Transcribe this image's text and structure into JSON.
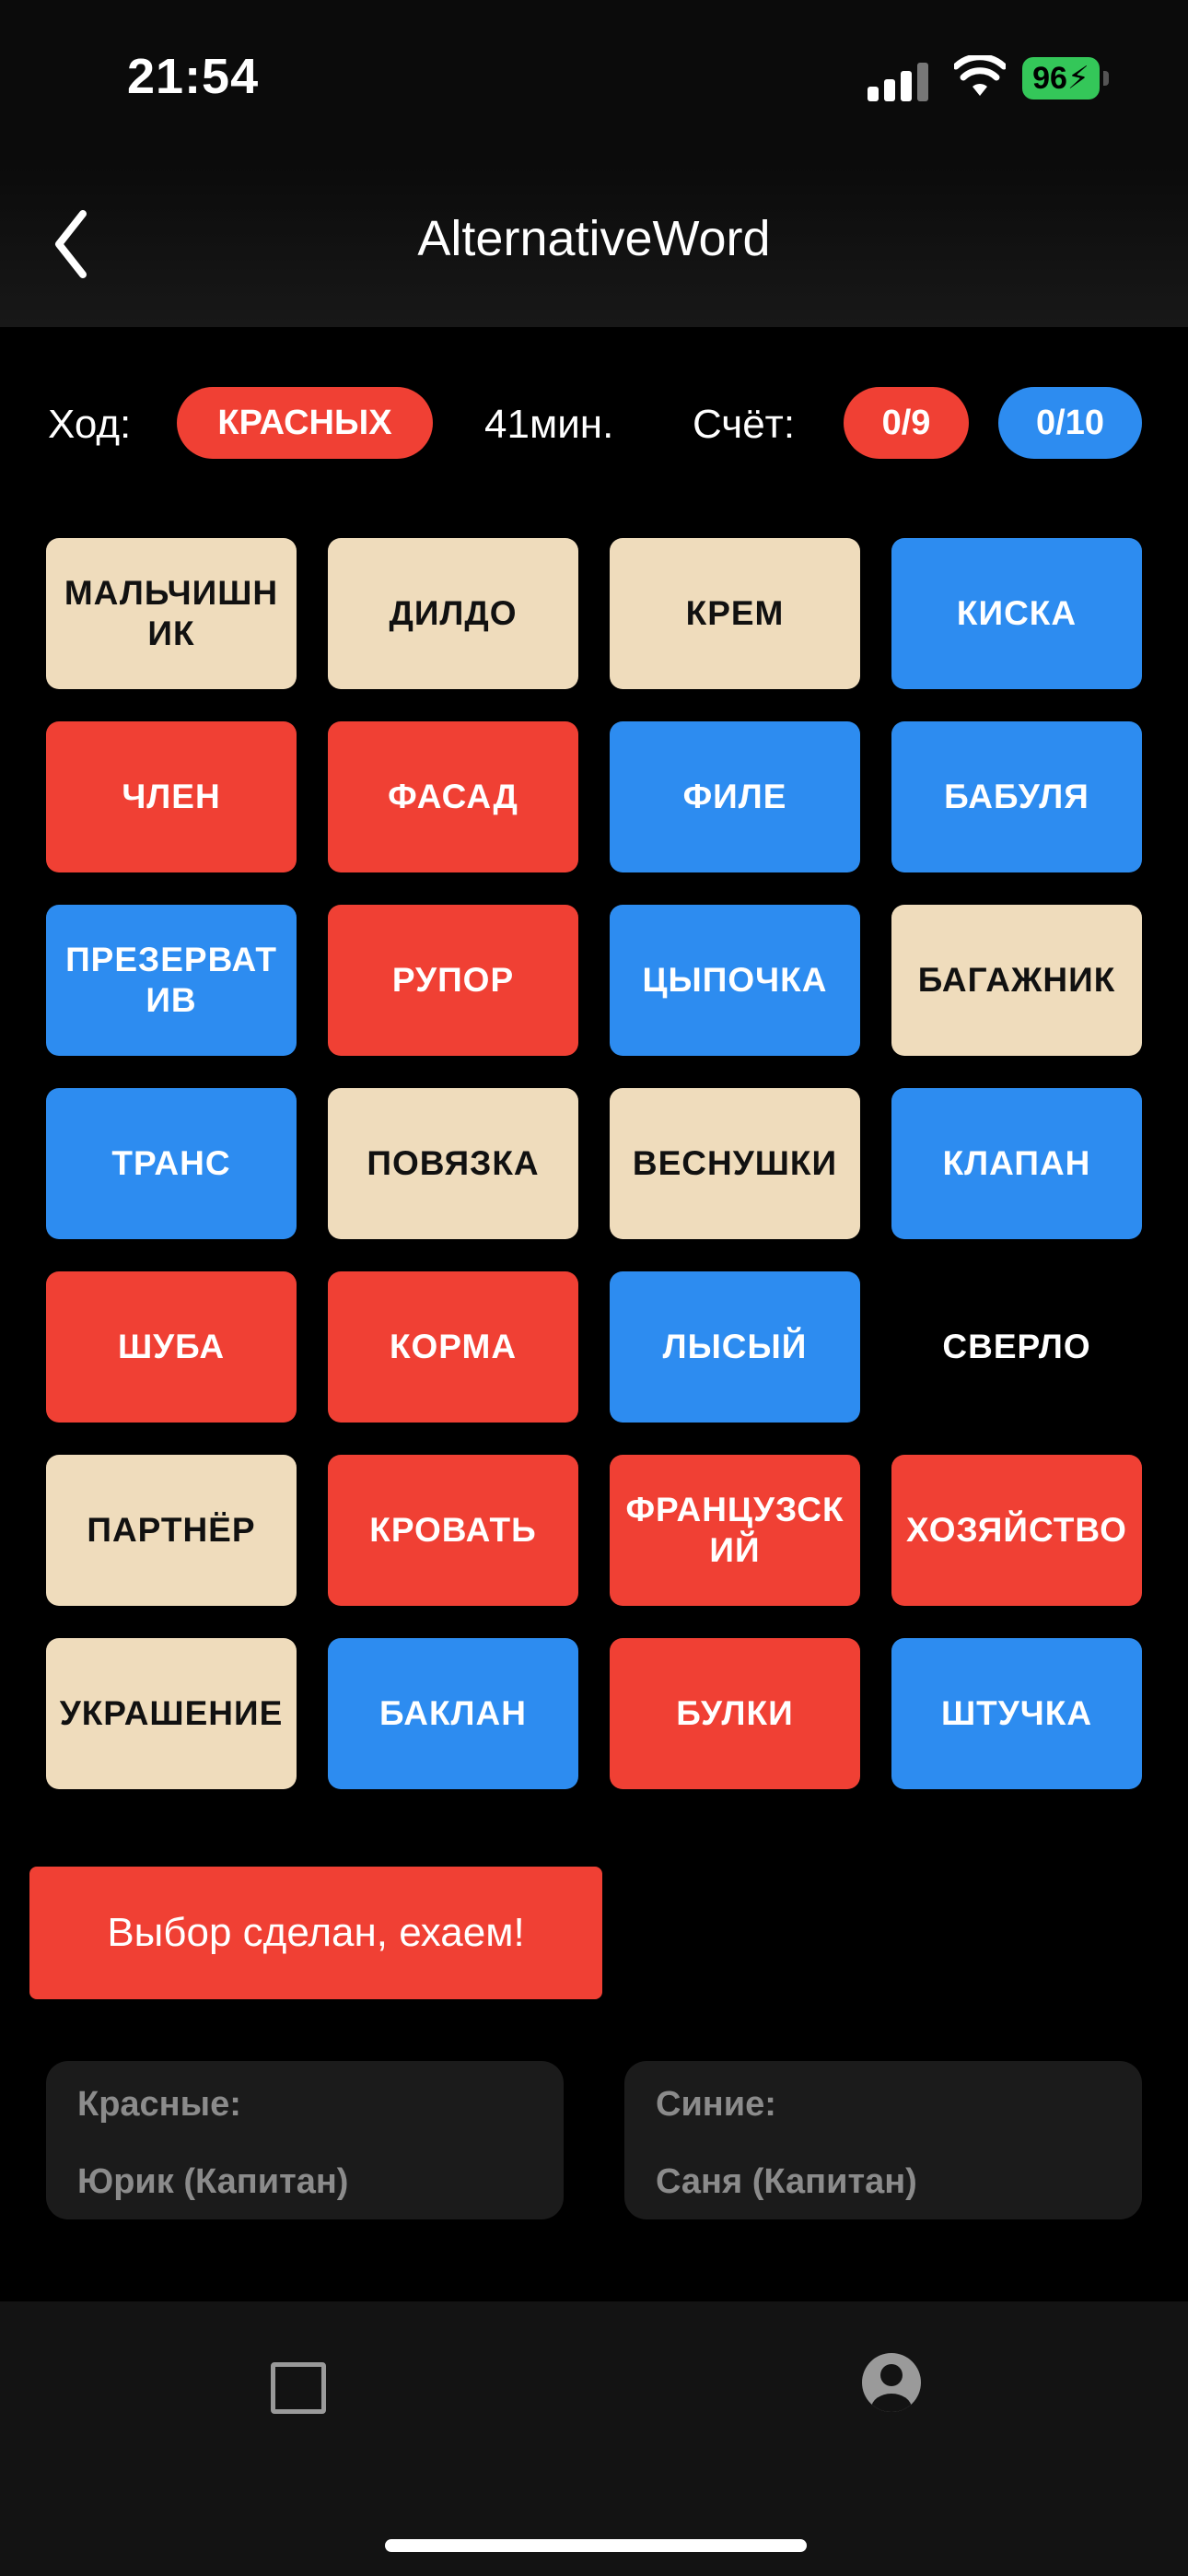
{
  "status": {
    "time": "21:54",
    "battery": "96"
  },
  "nav": {
    "title": "AlternativeWord",
    "back_icon": "chevron-left-icon"
  },
  "info": {
    "turn_label": "Ход:",
    "turn_team": "КРАСНЫХ",
    "timer": "41мин.",
    "score_label": "Счёт:",
    "score_red": "0/9",
    "score_blue": "0/10"
  },
  "colors": {
    "red": "#f04034",
    "blue": "#2d8cf0",
    "beige": "#efdcbc",
    "black": "#000000"
  },
  "cards": [
    {
      "word": "МАЛЬЧИШНИК",
      "color": "beige"
    },
    {
      "word": "ДИЛДО",
      "color": "beige"
    },
    {
      "word": "КРЕМ",
      "color": "beige"
    },
    {
      "word": "КИСКА",
      "color": "blue"
    },
    {
      "word": "ЧЛЕН",
      "color": "red"
    },
    {
      "word": "ФАСАД",
      "color": "red"
    },
    {
      "word": "ФИЛЕ",
      "color": "blue"
    },
    {
      "word": "БАБУЛЯ",
      "color": "blue"
    },
    {
      "word": "ПРЕЗЕРВАТИВ",
      "color": "blue"
    },
    {
      "word": "РУПОР",
      "color": "red"
    },
    {
      "word": "ЦЫПОЧКА",
      "color": "blue"
    },
    {
      "word": "БАГАЖНИК",
      "color": "beige"
    },
    {
      "word": "ТРАНС",
      "color": "blue"
    },
    {
      "word": "ПОВЯЗКА",
      "color": "beige"
    },
    {
      "word": "ВЕСНУШКИ",
      "color": "beige"
    },
    {
      "word": "КЛАПАН",
      "color": "blue"
    },
    {
      "word": "ШУБА",
      "color": "red"
    },
    {
      "word": "КОРМА",
      "color": "red"
    },
    {
      "word": "ЛЫСЫЙ",
      "color": "blue"
    },
    {
      "word": "СВЕРЛО",
      "color": "black"
    },
    {
      "word": "ПАРТНЁР",
      "color": "beige"
    },
    {
      "word": "КРОВАТЬ",
      "color": "red"
    },
    {
      "word": "ФРАНЦУЗСКИЙ",
      "color": "red"
    },
    {
      "word": "ХОЗЯЙСТВО",
      "color": "red"
    },
    {
      "word": "УКРАШЕНИЕ",
      "color": "beige"
    },
    {
      "word": "БАКЛАН",
      "color": "blue"
    },
    {
      "word": "БУЛКИ",
      "color": "red"
    },
    {
      "word": "ШТУЧКА",
      "color": "blue"
    }
  ],
  "action": {
    "confirm_label": "Выбор сделан, ехаем!"
  },
  "teams": {
    "red": {
      "label": "Красные:",
      "player": "Юрик (Капитан)"
    },
    "blue": {
      "label": "Синие:",
      "player": "Саня (Капитан)"
    }
  },
  "tabbar": {
    "tab1_icon": "square-icon",
    "tab2_icon": "user-circle-icon"
  }
}
